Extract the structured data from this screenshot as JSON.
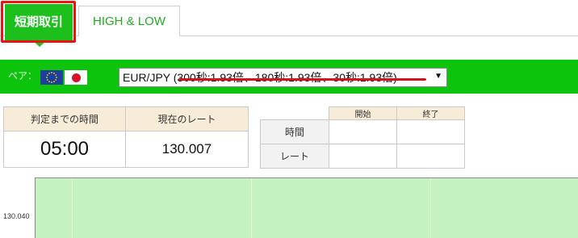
{
  "tabs": [
    {
      "label": "短期取引",
      "active": true
    },
    {
      "label": "HIGH & LOW",
      "active": false
    }
  ],
  "pair": {
    "label": "ペア：",
    "flags": [
      "eu-flag-icon",
      "jp-flag-icon"
    ],
    "selected": "EUR/JPY (300秒:1.93倍、180秒:1.93倍、30秒:1.93倍)"
  },
  "timer": {
    "header": "判定までの時間",
    "value": "05:00"
  },
  "rate": {
    "header": "現在のレート",
    "value": "130.007"
  },
  "period_table": {
    "columns": [
      "開始",
      "終了"
    ],
    "rows": [
      {
        "label": "時間",
        "start": "",
        "end": ""
      },
      {
        "label": "レート",
        "start": "",
        "end": ""
      }
    ]
  },
  "chart": {
    "y_tick": "130.040"
  },
  "colors": {
    "accent": "#1dbf1d",
    "bar": "#0cc40c",
    "highlight": "#ee1111",
    "chart_bg": "#c4f2c0"
  }
}
